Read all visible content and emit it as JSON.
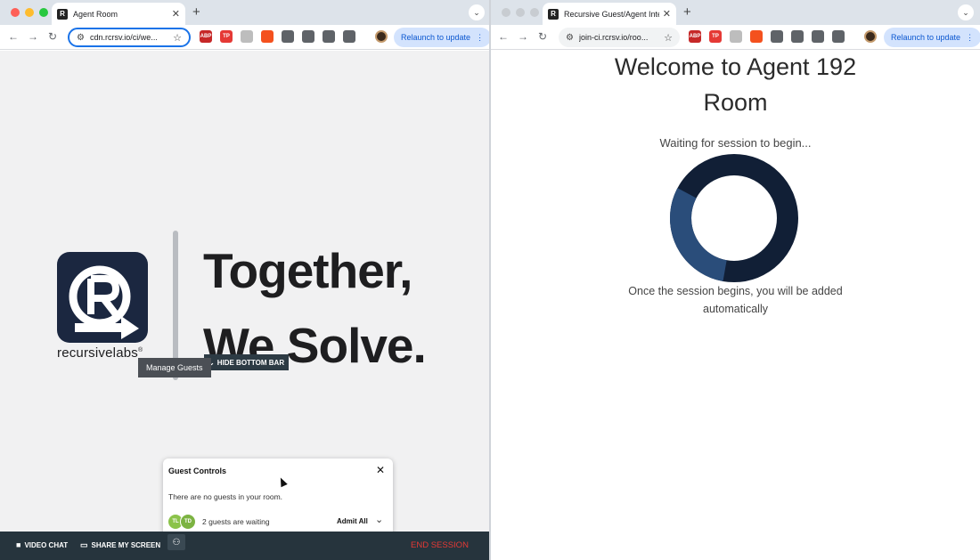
{
  "left_window": {
    "tab_title": "Agent Room",
    "favicon": "R",
    "url": "cdn.rcrsv.io/ci/we...",
    "relaunch_label": "Relaunch to update",
    "extensions": [
      {
        "label": "ABP",
        "color": "#c62828"
      },
      {
        "label": "TP",
        "color": "#e53935"
      },
      {
        "label": "",
        "color": "#bdbdbd"
      },
      {
        "label": "",
        "color": "#f4511e"
      },
      {
        "label": "",
        "color": "#5f6368"
      },
      {
        "label": "",
        "color": "#5f6368"
      },
      {
        "label": "",
        "color": "#5f6368"
      },
      {
        "label": "",
        "color": "#5f6368"
      }
    ]
  },
  "right_window": {
    "tab_title": "Recursive Guest/Agent Interfa",
    "favicon": "R",
    "url": "join-ci.rcrsv.io/roo...",
    "relaunch_label": "Relaunch to update",
    "extensions": [
      {
        "label": "ABP",
        "color": "#c62828"
      },
      {
        "label": "TP",
        "color": "#e53935"
      },
      {
        "label": "",
        "color": "#bdbdbd"
      },
      {
        "label": "",
        "color": "#f4511e"
      },
      {
        "label": "",
        "color": "#5f6368"
      },
      {
        "label": "",
        "color": "#5f6368"
      },
      {
        "label": "",
        "color": "#5f6368"
      },
      {
        "label": "",
        "color": "#5f6368"
      }
    ]
  },
  "agent_page": {
    "brand_bold": "recursive",
    "brand_thin": "labs",
    "brand_mark": "®",
    "tagline_line1": "Together,",
    "tagline_line2": "We Solve.",
    "tooltip": "Manage Guests",
    "hide_bar_label": "HIDE BOTTOM BAR",
    "guest_controls": {
      "title": "Guest Controls",
      "empty_message": "There are no guests in your room.",
      "waiting_text": "2 guests are waiting",
      "admit_all": "Admit All",
      "avatars": [
        {
          "initials": "TL",
          "color": "#8bc34a"
        },
        {
          "initials": "TD",
          "color": "#7cb342"
        }
      ]
    },
    "bottom_bar": {
      "video_chat": "VIDEO CHAT",
      "share_screen": "SHARE MY SCREEN",
      "end_session": "END SESSION"
    }
  },
  "guest_page": {
    "welcome_line1": "Welcome to Agent 192",
    "welcome_line2": "Room",
    "waiting": "Waiting for session to begin...",
    "spinner_progress": 0.3,
    "once_line1": "Once the session begins, you will be added",
    "once_line2": "automatically"
  },
  "colors": {
    "brand_navy": "#1b2740",
    "spinner_dark": "#111f36",
    "spinner_light": "#2a4d7a",
    "bottom_bar": "#26343d",
    "end_session": "#e53935"
  }
}
